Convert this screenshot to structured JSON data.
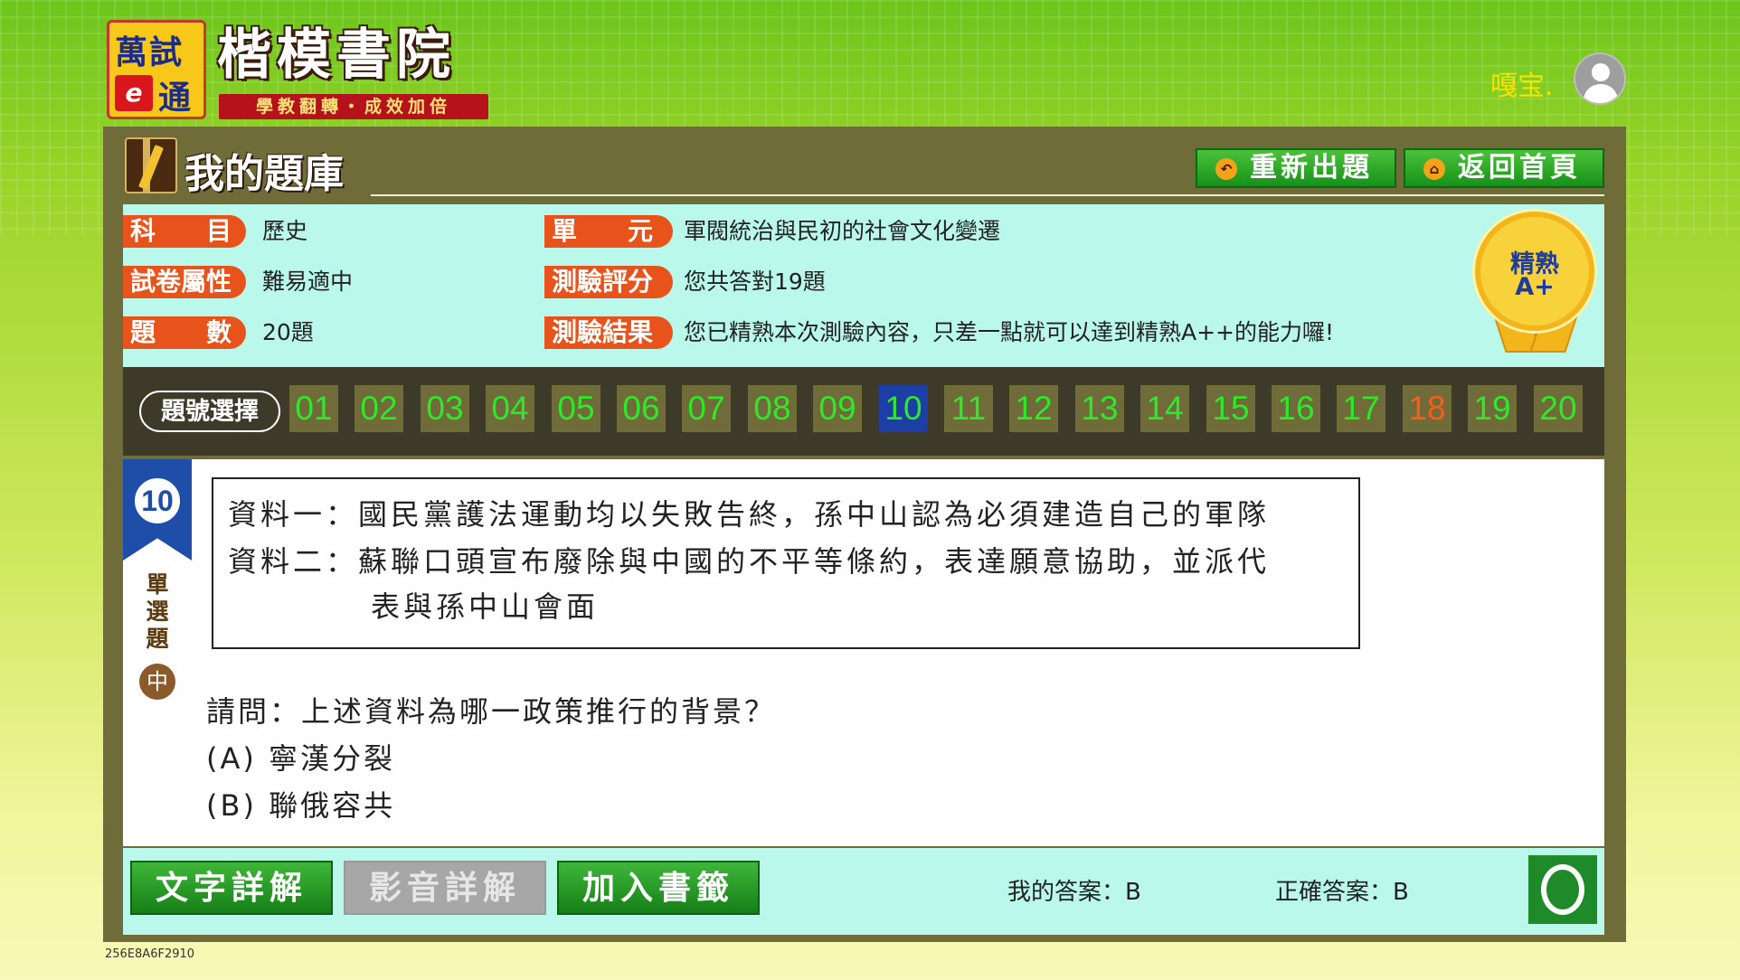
{
  "header": {
    "logo_left_line1": "萬試",
    "logo_left_e": "e",
    "logo_left_line2": "通",
    "logo_title": "楷模書院",
    "logo_slogan": "學教翻轉・成效加倍",
    "user_name": "嘎宝."
  },
  "page": {
    "title": "我的題庫",
    "reset_button": "重新出題",
    "home_button": "返回首頁"
  },
  "info": {
    "subject_label": "科　　目",
    "subject_value": "歷史",
    "paper_label": "試卷屬性",
    "paper_value": "難易適中",
    "count_label": "題　　數",
    "count_value": "20題",
    "unit_label": "單　　元",
    "unit_value": "軍閥統治與民初的社會文化變遷",
    "score_label": "測驗評分",
    "score_value": "您共答對19題",
    "result_label": "測驗結果",
    "result_value": "您已精熟本次測驗內容，只差一點就可以達到精熟A++的能力囉!",
    "badge_line1": "精熟",
    "badge_line2": "A+"
  },
  "question_nav": {
    "label": "題號選擇",
    "numbers": [
      "01",
      "02",
      "03",
      "04",
      "05",
      "06",
      "07",
      "08",
      "09",
      "10",
      "11",
      "12",
      "13",
      "14",
      "15",
      "16",
      "17",
      "18",
      "19",
      "20"
    ],
    "active": "10",
    "wrong": [
      "18"
    ],
    "colors": {
      "correct": "#2ee82a",
      "wrong": "#ff5a1a",
      "active_bg": "#1b3fa5"
    }
  },
  "question": {
    "number": "10",
    "type": "單選題",
    "type_chars": [
      "單",
      "選",
      "題"
    ],
    "difficulty": "中",
    "source_line1": "資料一：國民黨護法運動均以失敗告終，孫中山認為必須建造自己的軍隊",
    "source_line2": "資料二：蘇聯口頭宣布廢除與中國的不平等條約，表達願意協助，並派代",
    "source_line3": "表與孫中山會面",
    "prompt": "請問：上述資料為哪一政策推行的背景？",
    "option_a": "(A) 寧漢分裂",
    "option_b": "(B) 聯俄容共"
  },
  "bottom": {
    "text_explain": "文字詳解",
    "video_explain": "影音詳解",
    "bookmark": "加入書籤",
    "my_answer": "我的答案：B",
    "correct_answer": "正確答案：B",
    "result_icon": "correct-circle-icon"
  },
  "footer": {
    "id": "256E8A6F2910"
  }
}
